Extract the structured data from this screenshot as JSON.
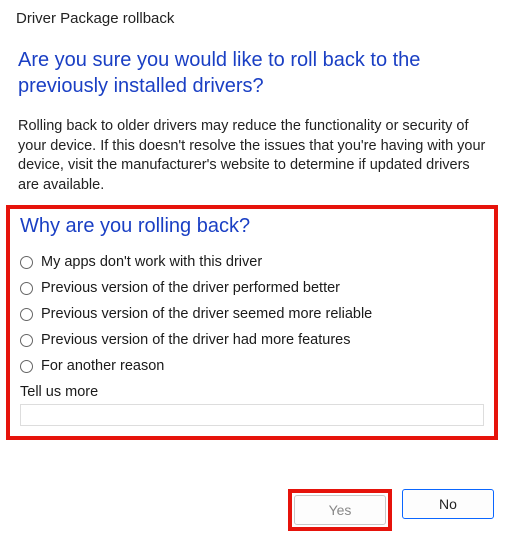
{
  "window": {
    "title": "Driver Package rollback"
  },
  "headline": "Are you sure you would like to roll back to the previously installed drivers?",
  "body": "Rolling back to older drivers may reduce the functionality or security of your device. If this doesn't resolve the issues that you're having with your device, visit the manufacturer's website to determine if updated drivers are available.",
  "section_heading": "Why are you rolling back?",
  "reasons": [
    "My apps don't work with this driver",
    "Previous version of the driver performed better",
    "Previous version of the driver seemed more reliable",
    "Previous version of the driver had more features",
    "For another reason"
  ],
  "tell_more": {
    "label": "Tell us more",
    "value": ""
  },
  "buttons": {
    "yes": "Yes",
    "no": "No"
  }
}
